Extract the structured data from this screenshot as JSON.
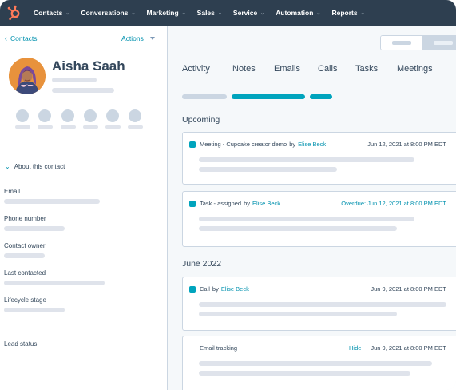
{
  "topnav": {
    "items": [
      {
        "label": "Contacts"
      },
      {
        "label": "Conversations"
      },
      {
        "label": "Marketing"
      },
      {
        "label": "Sales"
      },
      {
        "label": "Service"
      },
      {
        "label": "Automation"
      },
      {
        "label": "Reports"
      }
    ],
    "brand_color": "#ff7a59",
    "bg_color": "#2e3f50"
  },
  "sidebar": {
    "back_label": "Contacts",
    "actions_label": "Actions",
    "contact_name": "Aisha Saah",
    "about_label": "About this contact",
    "fields": [
      {
        "label": "Email"
      },
      {
        "label": "Phone number"
      },
      {
        "label": "Contact owner"
      },
      {
        "label": "Last contacted"
      },
      {
        "label": "Lifecycle stage"
      },
      {
        "label": "Lead status"
      }
    ]
  },
  "main": {
    "tabs": [
      {
        "label": "Activity"
      },
      {
        "label": "Notes"
      },
      {
        "label": "Emails"
      },
      {
        "label": "Calls"
      },
      {
        "label": "Tasks"
      },
      {
        "label": "Meetings"
      }
    ],
    "upcoming_title": "Upcoming",
    "month_title": "June 2022",
    "cards": [
      {
        "type": "Meeting - Cupcake creator demo",
        "by": "by",
        "owner": "Elise Beck",
        "date": "Jun 12, 2021 at 8:00 PM EDT"
      },
      {
        "type": "Task - assigned",
        "by": "by",
        "owner": "Elise Beck",
        "date": "Overdue: Jun 12, 2021 at 8:00 PM EDT"
      },
      {
        "type": "Call",
        "by": "by",
        "owner": "Elise Beck",
        "date": "Jun 9, 2021 at 8:00 PM EDT"
      },
      {
        "type": "Email tracking",
        "hide": "Hide",
        "date": "Jun 9, 2021 at 8:00 PM EDT"
      }
    ],
    "accent_color": "#00a4bd"
  }
}
